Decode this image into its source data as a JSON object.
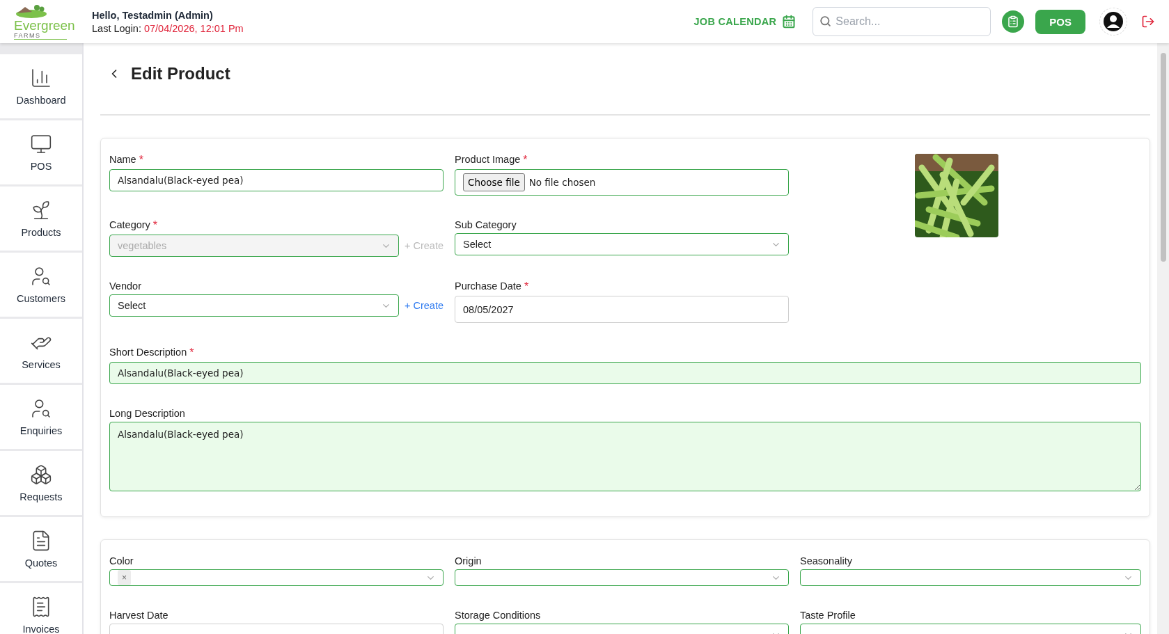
{
  "header": {
    "logo": {
      "name": "Evergreen",
      "sub": "FARMS"
    },
    "greeting": "Hello, Testadmin (Admin)",
    "last_login_label": "Last Login:",
    "last_login_value": "07/04/2026, 12:01 Pm",
    "job_calendar": "JOB CALENDAR",
    "search": {
      "placeholder": "Search..."
    },
    "pos_button": "POS"
  },
  "sidebar": {
    "items": [
      {
        "label": "Dashboard",
        "kind": "dashboard"
      },
      {
        "label": "POS",
        "kind": "pos"
      },
      {
        "label": "Products",
        "kind": "products"
      },
      {
        "label": "Customers",
        "kind": "customers"
      },
      {
        "label": "Services",
        "kind": "services"
      },
      {
        "label": "Enquiries",
        "kind": "enquiries"
      },
      {
        "label": "Requests",
        "kind": "requests"
      },
      {
        "label": "Quotes",
        "kind": "quotes"
      },
      {
        "label": "Invoices",
        "kind": "invoices"
      }
    ]
  },
  "page": {
    "title": "Edit Product"
  },
  "details": {
    "name": {
      "label": "Name",
      "mark": "*",
      "value": "Alsandalu(Black-eyed pea)",
      "valid": true
    },
    "product_image": {
      "label": "Product Image",
      "mark": "*",
      "button": "Choose file",
      "status": "No file chosen",
      "valid": true
    },
    "category": {
      "label": "Category",
      "mark": "*",
      "value": "vegetables",
      "disabled": true,
      "valid": true,
      "create_link": {
        "label": "+ Create",
        "disabled": true
      }
    },
    "sub_category": {
      "label": "Sub Category",
      "value": "Select",
      "disabled": false,
      "valid": true
    },
    "vendor": {
      "label": "Vendor",
      "value": "Select",
      "disabled": false,
      "valid": true,
      "create_link": {
        "label": "+ Create",
        "disabled": false
      }
    },
    "purchase_date": {
      "label": "Purchase Date",
      "mark": "*",
      "value": "08/05/2027",
      "valid": false
    },
    "short_description": {
      "label": "Short Description",
      "mark": "*",
      "value": "Alsandalu(Black-eyed pea)",
      "valid": true
    },
    "long_description": {
      "label": "Long Description",
      "value": "Alsandalu(Black-eyed pea)",
      "valid": true
    }
  },
  "attributes": {
    "fields": [
      {
        "label": "Color",
        "kind": "multiselect",
        "chip_remove": "×",
        "valid": true
      },
      {
        "label": "Origin",
        "kind": "select",
        "valid": true
      },
      {
        "label": "Seasonality",
        "kind": "select",
        "valid": true
      },
      {
        "label": "Harvest Date",
        "kind": "date",
        "valid": false
      },
      {
        "label": "Storage Conditions",
        "kind": "select",
        "valid": true
      },
      {
        "label": "Taste Profile",
        "kind": "select",
        "valid": true
      }
    ]
  }
}
